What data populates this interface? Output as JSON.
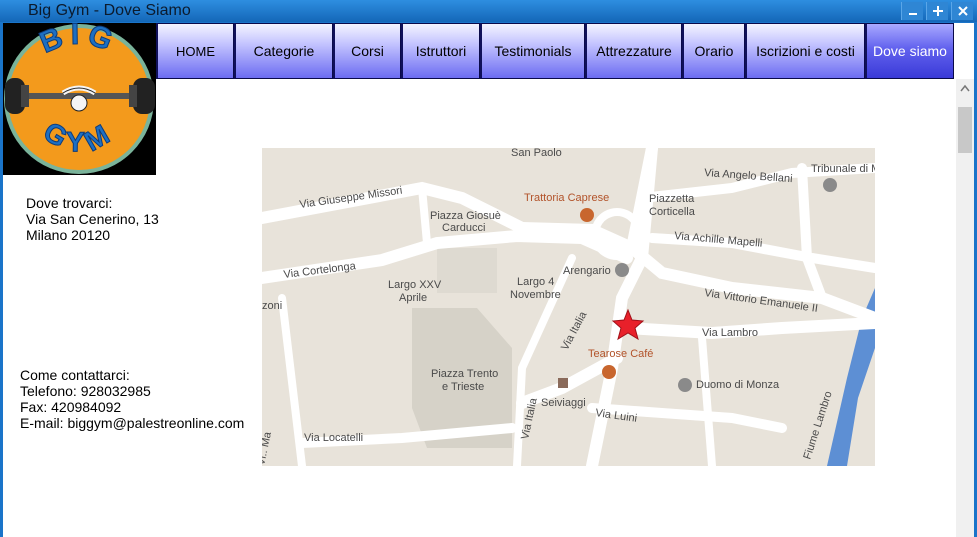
{
  "window": {
    "title": "Big Gym - Dove Siamo"
  },
  "logo": {
    "top_text": "BIG",
    "bottom_text": "GYM"
  },
  "nav": {
    "items": [
      {
        "label": "HOME"
      },
      {
        "label": "Categorie"
      },
      {
        "label": "Corsi"
      },
      {
        "label": "Istruttori"
      },
      {
        "label": "Testimonials"
      },
      {
        "label": "Attrezzature"
      },
      {
        "label": "Orario"
      },
      {
        "label": "Iscrizioni e costi"
      },
      {
        "label": "Dove siamo"
      }
    ],
    "active": "Dove siamo"
  },
  "address": {
    "heading": "Dove trovarci:",
    "street": "Via San Cenerino, 13",
    "city": "Milano 20120"
  },
  "contact": {
    "heading": "Come contattarci:",
    "phone": "Telefono: 928032985",
    "fax": "Fax: 420984092",
    "email": "E-mail: biggym@palestreonline.com"
  },
  "map": {
    "labels": {
      "san_paolo": "San Paolo",
      "angelo_bellani": "Via Angelo Bellani",
      "tribunale": "Tribunale di M",
      "missori": "Via Giuseppe Missori",
      "trattoria": "Trattoria Caprese",
      "carducci_1": "Piazza Giosuè",
      "carducci_2": "Carducci",
      "corticella_1": "Piazzetta",
      "corticella_2": "Corticella",
      "mapelli": "Via Achille Mapelli",
      "cortelonga": "Via Cortelonga",
      "arengario": "Arengario",
      "emanuele": "Via Vittorio Emanuele II",
      "largo25_1": "Largo XXV",
      "largo25_2": "Aprile",
      "largo4_1": "Largo 4",
      "largo4_2": "Novembre",
      "zoni": "zoni",
      "lambro_via": "Via Lambro",
      "via_italia": "Via Italia",
      "tearose": "Tearose Café",
      "trento_1": "Piazza Trento",
      "trento_2": "e Trieste",
      "duomo": "Duomo di Monza",
      "fiume": "Fiume Lambro",
      "seiviaggi": "Seiviaggi",
      "via_italia2": "Via Italia",
      "luini": "Via Luini",
      "locatelli": "Via Locatelli",
      "marconi": "Vi.. Ma"
    },
    "colors": {
      "background": "#e8e3da",
      "road": "#ffffff",
      "square": "#d6d2c8",
      "river": "#5d8fd4",
      "marker": "#e8202a",
      "poi": "#c8662e",
      "text": "#4a4a4a"
    }
  },
  "scrollbar": {
    "thumb_position_fraction": 0.06
  }
}
